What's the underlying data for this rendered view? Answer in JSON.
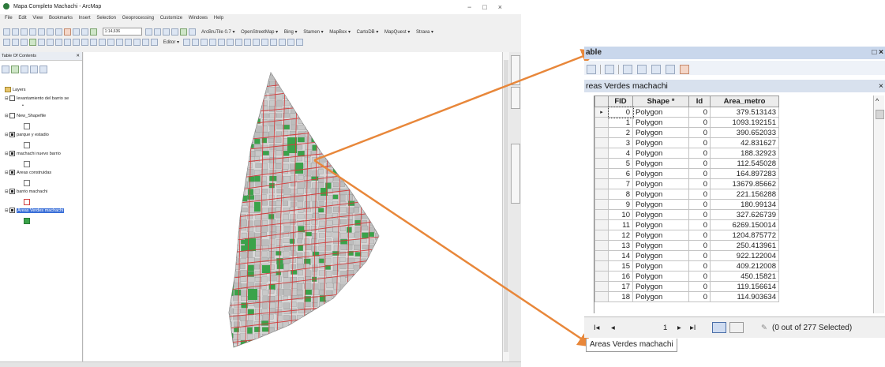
{
  "arcmap": {
    "window_title": "Mapa Completo Machachi - ArcMap",
    "window_controls": [
      "−",
      "□",
      "×"
    ],
    "menu": [
      "File",
      "Edit",
      "View",
      "Bookmarks",
      "Insert",
      "Selection",
      "Geoprocessing",
      "Customize",
      "Windows",
      "Help"
    ],
    "scale": "1:14,636",
    "toolbar_texts": [
      "ArcBruTile 0.7 ▾",
      "OpenStreetMap ▾",
      "Bing ▾",
      "Stamen ▾",
      "MapBox ▾",
      "CartoDB ▾",
      "MapQuest ▾",
      "Strava ▾"
    ],
    "editor_label": "Editor ▾",
    "toc": {
      "title": "Table Of Contents",
      "close": "✕",
      "root": "Layers",
      "layers": [
        {
          "name": "levantamiento del barrio se",
          "checked": false,
          "swatch": "",
          "swatch_glyph": "•"
        },
        {
          "name": "New_Shapefile",
          "checked": false,
          "swatch": "#ffffff"
        },
        {
          "name": "parque y estadio",
          "checked": true,
          "swatch": "#ffffff"
        },
        {
          "name": "machachi nuevo barrio",
          "checked": true,
          "swatch": "#ffffff"
        },
        {
          "name": "Areas construidas",
          "checked": true,
          "swatch": "#ffffff"
        },
        {
          "name": "barrio machachi",
          "checked": true,
          "swatch": "#ffffff",
          "swatch_border": "#d04040"
        },
        {
          "name": "Areas Verdes machachi",
          "checked": true,
          "swatch": "#3aa34a",
          "selected": true
        }
      ]
    },
    "side_tabs": [
      "Catalog",
      "Search",
      "Create Features"
    ]
  },
  "table_window": {
    "title": "able",
    "controls": "□ ×",
    "tab_name": "reas Verdes machachi",
    "tab_close": "×",
    "columns": [
      "FID",
      "Shape *",
      "Id",
      "Area_metro"
    ],
    "rows": [
      {
        "fid": "0",
        "shape": "Polygon",
        "id": "0",
        "area": "379.513143"
      },
      {
        "fid": "1",
        "shape": "Polygon",
        "id": "0",
        "area": "1093.192151"
      },
      {
        "fid": "2",
        "shape": "Polygon",
        "id": "0",
        "area": "390.652033"
      },
      {
        "fid": "3",
        "shape": "Polygon",
        "id": "0",
        "area": "42.831627"
      },
      {
        "fid": "4",
        "shape": "Polygon",
        "id": "0",
        "area": "188.32923"
      },
      {
        "fid": "5",
        "shape": "Polygon",
        "id": "0",
        "area": "112.545028"
      },
      {
        "fid": "6",
        "shape": "Polygon",
        "id": "0",
        "area": "164.897283"
      },
      {
        "fid": "7",
        "shape": "Polygon",
        "id": "0",
        "area": "13679.85662"
      },
      {
        "fid": "8",
        "shape": "Polygon",
        "id": "0",
        "area": "221.156288"
      },
      {
        "fid": "9",
        "shape": "Polygon",
        "id": "0",
        "area": "180.99134"
      },
      {
        "fid": "10",
        "shape": "Polygon",
        "id": "0",
        "area": "327.626739"
      },
      {
        "fid": "11",
        "shape": "Polygon",
        "id": "0",
        "area": "6269.150014"
      },
      {
        "fid": "12",
        "shape": "Polygon",
        "id": "0",
        "area": "1204.875772"
      },
      {
        "fid": "13",
        "shape": "Polygon",
        "id": "0",
        "area": "250.413961"
      },
      {
        "fid": "14",
        "shape": "Polygon",
        "id": "0",
        "area": "922.122004"
      },
      {
        "fid": "15",
        "shape": "Polygon",
        "id": "0",
        "area": "409.212008"
      },
      {
        "fid": "16",
        "shape": "Polygon",
        "id": "0",
        "area": "450.15821"
      },
      {
        "fid": "17",
        "shape": "Polygon",
        "id": "0",
        "area": "119.156614"
      },
      {
        "fid": "18",
        "shape": "Polygon",
        "id": "0",
        "area": "114.903634"
      }
    ],
    "nav": {
      "first": "I◂",
      "prev": "◂",
      "record": "1",
      "next": "▸",
      "last": "▸I"
    },
    "selection_status": "(0 out of 277 Selected)",
    "bottom_tab": "Areas Verdes machachi"
  },
  "colors": {
    "arrow": "#e8873a",
    "green_area": "#3aa34a",
    "road": "#d23c3c",
    "parcel": "#8c8c8c"
  }
}
